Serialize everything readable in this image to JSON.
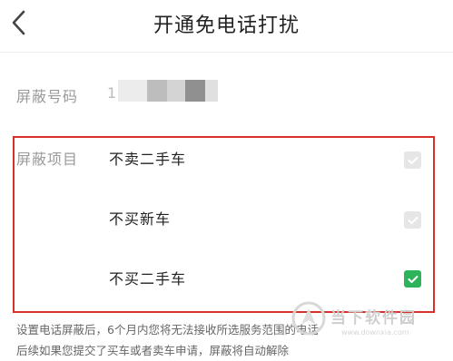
{
  "header": {
    "title": "开通免电话打扰",
    "back_icon": "chevron-left-icon"
  },
  "phone": {
    "label": "屏蔽号码",
    "value": "1"
  },
  "block_items": {
    "label": "屏蔽项目",
    "options": [
      {
        "label": "不卖二手车",
        "checked": false
      },
      {
        "label": "不买新车",
        "checked": false
      },
      {
        "label": "不买二手车",
        "checked": true
      }
    ]
  },
  "notes": [
    "设置电话屏蔽后，6个月内您将无法接收所选服务范围的电话",
    "后续如果您提交了买车或者卖车申请，屏蔽将自动解除"
  ],
  "watermark": {
    "text": "当下软件园",
    "url": "www.downxia.com"
  },
  "colors": {
    "checked": "#2db35a",
    "unchecked": "#e6e6e6",
    "highlight_border": "#d9302c"
  }
}
